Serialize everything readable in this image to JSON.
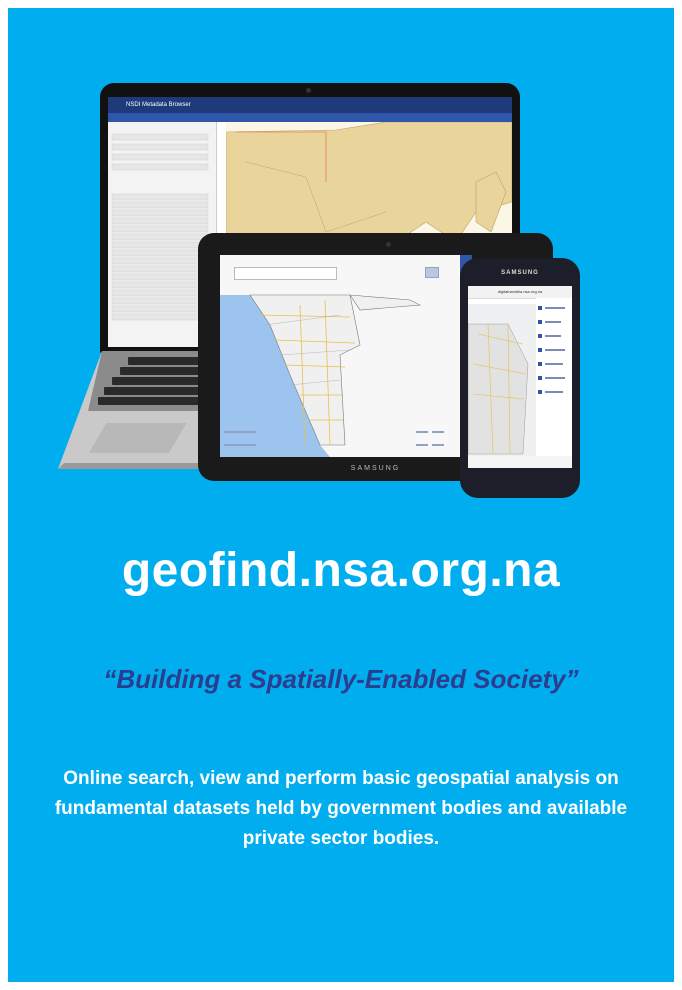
{
  "url": "geofind.nsa.org.na",
  "tagline": "“Building a Spatially-Enabled Society”",
  "description": "Online search, view and perform basic geospatial analysis on fundamental datasets held by government bodies and available private sector bodies.",
  "devices": {
    "laptop_app_title": "NSDI Metadata Browser",
    "tablet_brand": "SAMSUNG",
    "phone_brand": "SAMSUNG",
    "phone_url": "digitalnamibia.nsa.org.na"
  },
  "colors": {
    "background": "#00aeef",
    "tagline": "#2b3d8f",
    "text": "#ffffff"
  }
}
